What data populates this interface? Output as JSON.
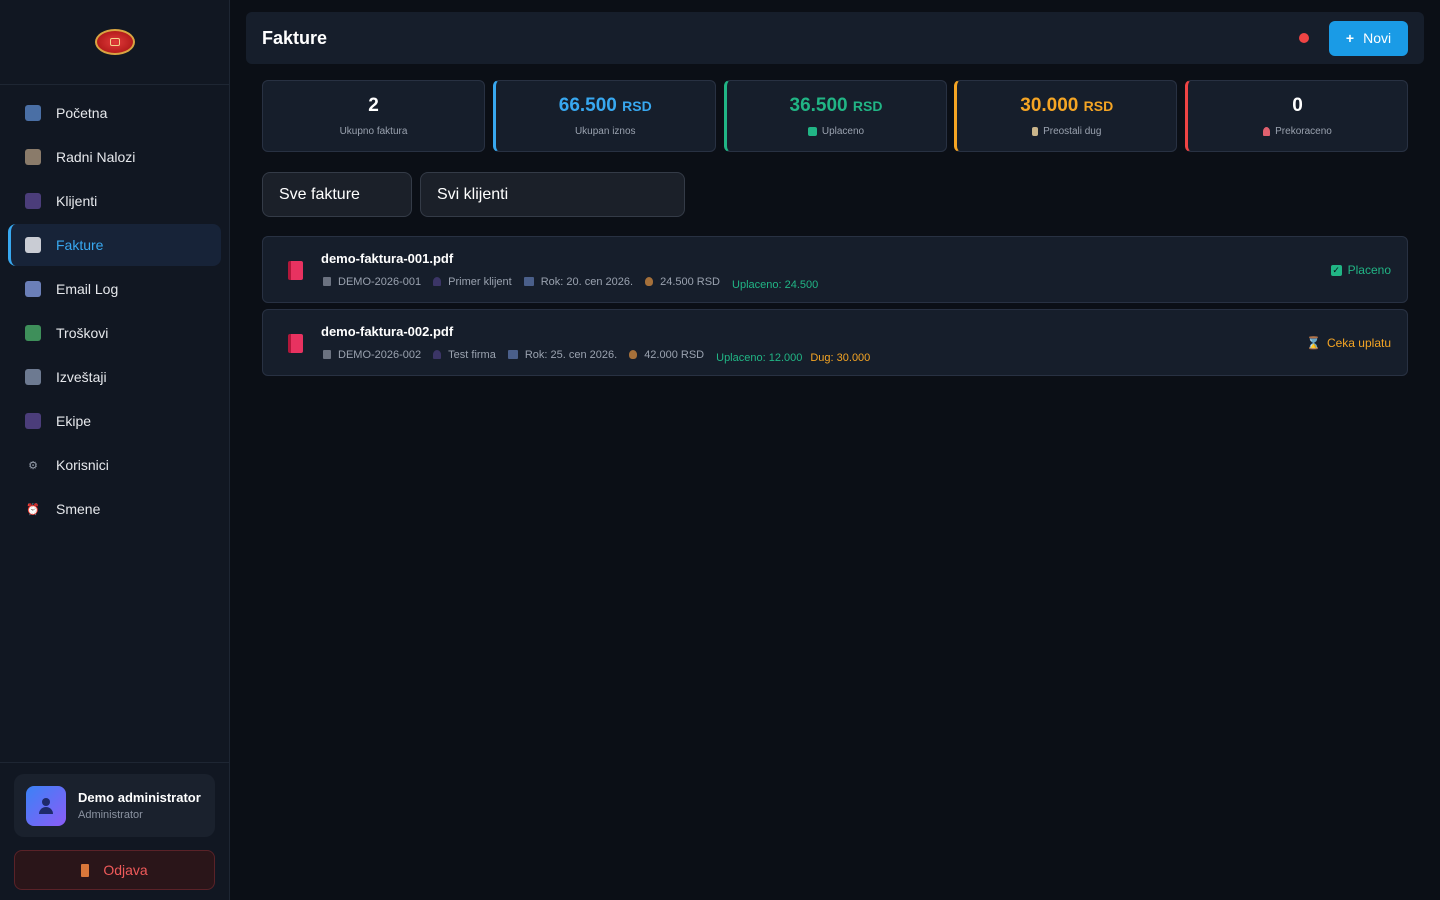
{
  "sidebar": {
    "items": [
      {
        "label": "Početna",
        "icon": "chart-icon",
        "active": false
      },
      {
        "label": "Radni Nalozi",
        "icon": "clipboard-icon",
        "active": false
      },
      {
        "label": "Klijenti",
        "icon": "users-icon",
        "active": false
      },
      {
        "label": "Fakture",
        "icon": "document-icon",
        "active": true
      },
      {
        "label": "Email Log",
        "icon": "email-icon",
        "active": false
      },
      {
        "label": "Troškovi",
        "icon": "money-icon",
        "active": false
      },
      {
        "label": "Izveštaji",
        "icon": "trend-icon",
        "active": false
      },
      {
        "label": "Ekipe",
        "icon": "team-icon",
        "active": false
      },
      {
        "label": "Korisnici",
        "icon": "gear-icon",
        "active": false
      },
      {
        "label": "Smene",
        "icon": "clock-icon",
        "active": false
      }
    ],
    "user": {
      "name": "Demo administrator",
      "role": "Administrator"
    },
    "logout_label": "Odjava"
  },
  "header": {
    "title": "Fakture",
    "new_button": "Novi",
    "new_plus": "+"
  },
  "stats": [
    {
      "value": "2",
      "unit": "",
      "label": "Ukupno faktura",
      "icon": ""
    },
    {
      "value": "66.500",
      "unit": "RSD",
      "label": "Ukupan iznos",
      "icon": ""
    },
    {
      "value": "36.500",
      "unit": "RSD",
      "label": "Uplaceno",
      "icon": "check-icon"
    },
    {
      "value": "30.000",
      "unit": "RSD",
      "label": "Preostali dug",
      "icon": "hourglass-icon"
    },
    {
      "value": "0",
      "unit": "",
      "label": "Prekoraceno",
      "icon": "alarm-icon"
    }
  ],
  "filters": {
    "status": "Sve fakture",
    "client": "Svi klijenti"
  },
  "invoices": [
    {
      "file": "demo-faktura-001.pdf",
      "number": "DEMO-2026-001",
      "client": "Primer klijent",
      "due": "Rok: 20. cen 2026.",
      "amount": "24.500 RSD",
      "paid": "Uplaceno: 24.500",
      "debt": "",
      "status": "Placeno"
    },
    {
      "file": "demo-faktura-002.pdf",
      "number": "DEMO-2026-002",
      "client": "Test firma",
      "due": "Rok: 25. cen 2026.",
      "amount": "42.000 RSD",
      "paid": "Uplaceno: 12.000",
      "debt": "Dug: 30.000",
      "status": "Ceka uplatu"
    }
  ],
  "colors": {
    "accent": "#38a8f0",
    "green": "#21b585",
    "orange": "#f5a524",
    "red": "#ef4444"
  }
}
